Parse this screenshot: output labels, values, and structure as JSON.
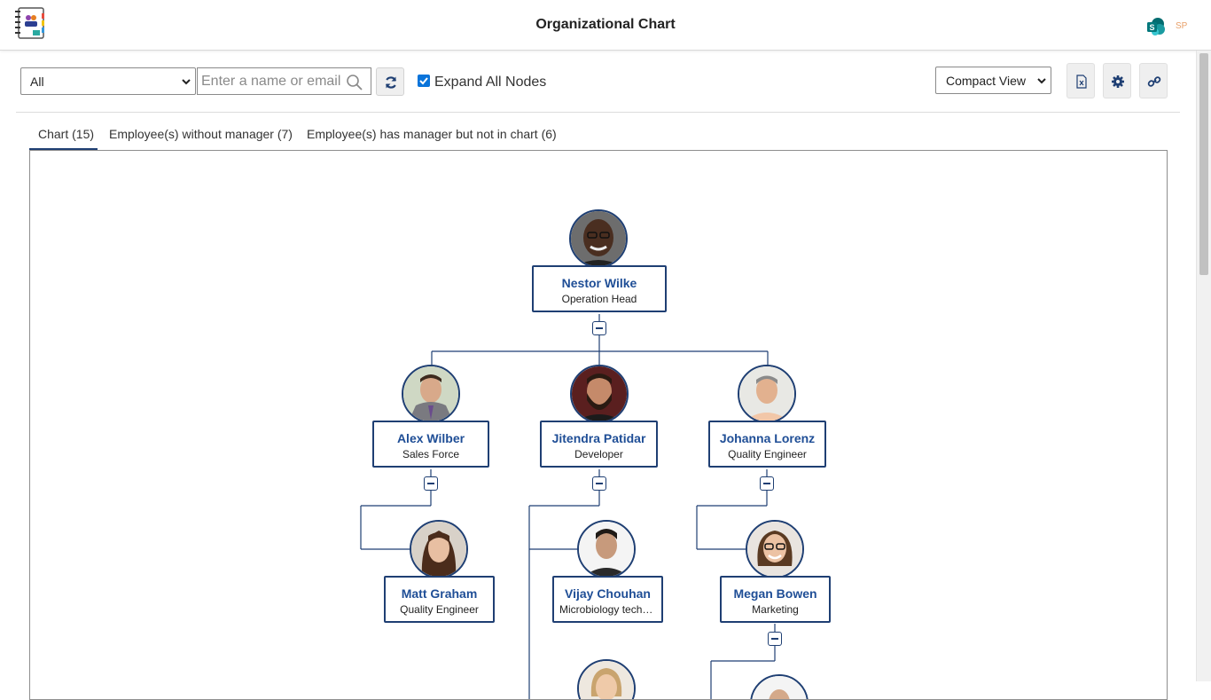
{
  "header": {
    "title": "Organizational Chart",
    "user_initials": "SP",
    "logo_icon": "org-chart-app-icon",
    "app_icon": "sharepoint-icon"
  },
  "toolbar": {
    "filter_value": "All",
    "search_placeholder": "Enter a name or email",
    "expand_label": "Expand All Nodes",
    "expand_checked": true,
    "view_value": "Compact View",
    "icons": [
      "refresh-icon",
      "excel-export-icon",
      "settings-icon",
      "link-icon"
    ]
  },
  "tabs": [
    {
      "label": "Chart (15)",
      "active": true
    },
    {
      "label": "Employee(s) without manager (7)",
      "active": false
    },
    {
      "label": "Employee(s) has manager but not in chart (6)",
      "active": false
    }
  ],
  "nodes": {
    "nestor": {
      "name": "Nestor Wilke",
      "title": "Operation Head"
    },
    "alex": {
      "name": "Alex Wilber",
      "title": "Sales Force"
    },
    "jitendra": {
      "name": "Jitendra Patidar",
      "title": "Developer"
    },
    "johanna": {
      "name": "Johanna Lorenz",
      "title": "Quality Engineer"
    },
    "matt": {
      "name": "Matt Graham",
      "title": "Quality Engineer"
    },
    "vijay": {
      "name": "Vijay Chouhan",
      "title": "Microbiology techn..."
    },
    "megan": {
      "name": "Megan Bowen",
      "title": "Marketing"
    }
  },
  "colors": {
    "accent": "#1f3f73",
    "name_text": "#1f4e96",
    "checkbox": "#0a74da"
  }
}
